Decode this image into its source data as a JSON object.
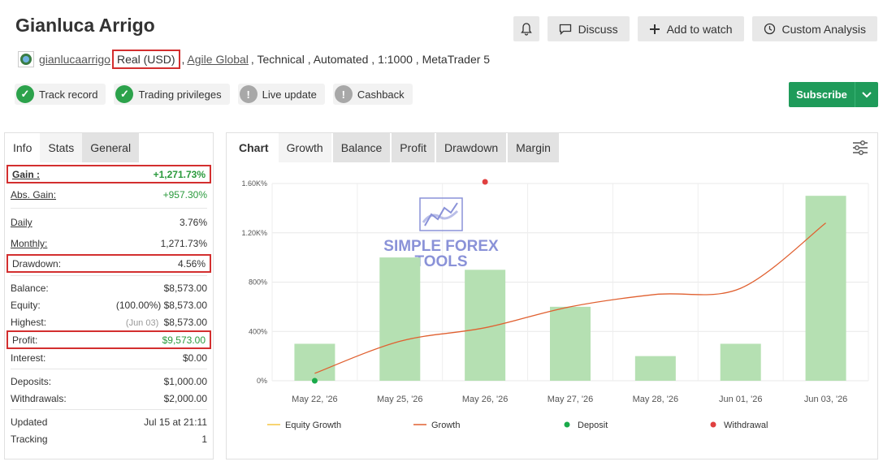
{
  "header": {
    "title": "Gianluca Arrigo",
    "username": "gianlucaarrigo",
    "account_type": "Real (USD)",
    "broker": "Agile Global",
    "rest": ", Technical , Automated , 1:1000 , MetaTrader 5",
    "sep_comma": ","
  },
  "actions": {
    "discuss": "Discuss",
    "add_to_watch": "Add to watch",
    "custom_analysis": "Custom Analysis"
  },
  "badges": [
    {
      "label": "Track record",
      "state": "ok"
    },
    {
      "label": "Trading privileges",
      "state": "ok"
    },
    {
      "label": "Live update",
      "state": "warn"
    },
    {
      "label": "Cashback",
      "state": "warn"
    }
  ],
  "subscribe": {
    "label": "Subscribe"
  },
  "info_tabs": [
    "Info",
    "Stats",
    "General"
  ],
  "stats": {
    "gain": {
      "label": "Gain :",
      "value": "+1,271.73%"
    },
    "abs_gain": {
      "label": "Abs. Gain:",
      "value": "+957.30%"
    },
    "daily": {
      "label": "Daily",
      "value": "3.76%"
    },
    "monthly": {
      "label": "Monthly:",
      "value": "1,271.73%"
    },
    "drawdown": {
      "label": "Drawdown:",
      "value": "4.56%"
    },
    "balance": {
      "label": "Balance:",
      "value": "$8,573.00"
    },
    "equity": {
      "label": "Equity:",
      "prefix": "(100.00%)",
      "value": "$8,573.00"
    },
    "highest": {
      "label": "Highest:",
      "prefix": "(Jun 03)",
      "value": "$8,573.00"
    },
    "profit": {
      "label": "Profit:",
      "value": "$9,573.00"
    },
    "interest": {
      "label": "Interest:",
      "value": "$0.00"
    },
    "deposits": {
      "label": "Deposits:",
      "value": "$1,000.00"
    },
    "withdrawals": {
      "label": "Withdrawals:",
      "value": "$2,000.00"
    },
    "updated": {
      "label": "Updated",
      "value": "Jul 15 at 21:11"
    },
    "tracking": {
      "label": "Tracking",
      "value": "1"
    }
  },
  "chart_tabs": [
    "Chart",
    "Growth",
    "Balance",
    "Profit",
    "Drawdown",
    "Margin"
  ],
  "watermark": {
    "line1": "SIMPLE FOREX",
    "line2": "TOOLS"
  },
  "chart_data": {
    "type": "bar",
    "categories": [
      "May 22, '26",
      "May 25, '26",
      "May 26, '26",
      "May 27, '26",
      "May 28, '26",
      "Jun 01, '26",
      "Jun 03, '26"
    ],
    "y_ticks": [
      "0%",
      "400%",
      "800%",
      "1.20K%",
      "1.60K%"
    ],
    "ylim": [
      0,
      1600
    ],
    "bars": [
      300,
      1000,
      900,
      600,
      200,
      300,
      1500
    ],
    "growth_line": [
      60,
      320,
      430,
      600,
      700,
      750,
      1280
    ],
    "deposit_point": {
      "index": 0,
      "value": 0
    },
    "withdrawal_point": {
      "index": 2,
      "value": 1600
    },
    "legend": [
      "Equity Growth",
      "Growth",
      "Deposit",
      "Withdrawal"
    ],
    "colors": {
      "bar": "#b5e0b2",
      "growth": "#e06030",
      "equity": "#f5c542",
      "deposit": "#1aaa4a",
      "withdrawal": "#e04040"
    }
  }
}
